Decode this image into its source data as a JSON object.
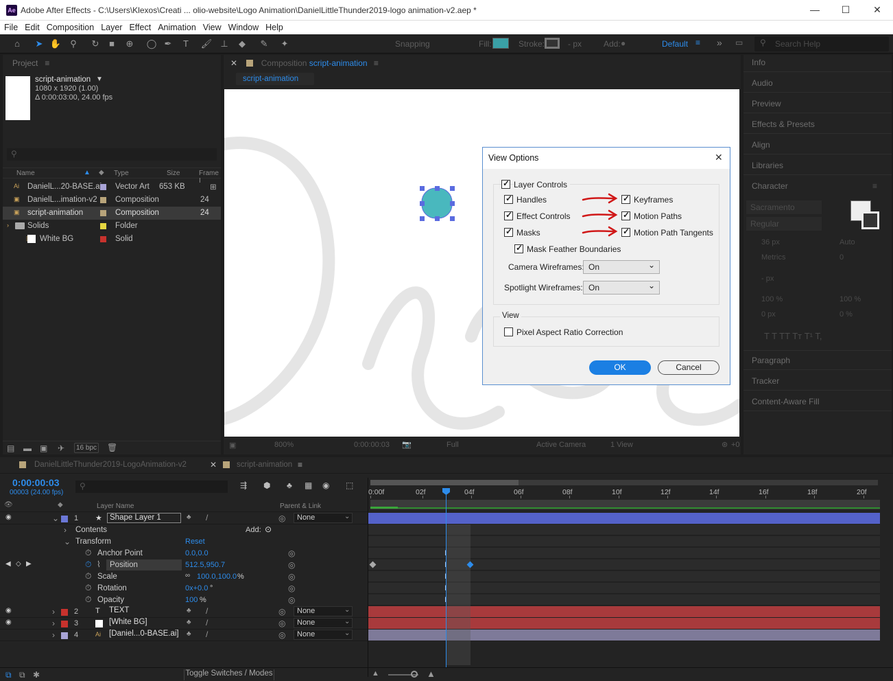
{
  "window": {
    "app_badge": "Ae",
    "title": "Adobe After Effects - C:\\Users\\Klexos\\Creati ... olio-website\\Logo Animation\\DanielLittleThunder2019-logo animation-v2.aep *",
    "minimize": "—",
    "maximize": "☐",
    "close": "✕"
  },
  "menu": [
    "File",
    "Edit",
    "Composition",
    "Layer",
    "Effect",
    "Animation",
    "View",
    "Window",
    "Help"
  ],
  "toolbar": {
    "snapping": "Snapping",
    "fill": "Fill:",
    "stroke": "Stroke:",
    "stroke_px": "- px",
    "add": "Add:",
    "workspace": "Default",
    "search": "Search Help"
  },
  "project": {
    "panel_title": "Project",
    "comp_name": "script-animation",
    "comp_dims": "1080 x 1920 (1.00)",
    "comp_dur": "Δ 0:00:03:00, 24.00 fps",
    "headers": {
      "name": "Name",
      "type": "Type",
      "size": "Size",
      "frame": "Frame I"
    },
    "items": [
      {
        "name": "DanielL...20-BASE.ai",
        "type": "Vector Art",
        "size": "653 KB",
        "frame": "",
        "color": "#a9a4d6"
      },
      {
        "name": "DanielL...imation-v2",
        "type": "Composition",
        "size": "",
        "frame": "24",
        "color": "#b8a47a"
      },
      {
        "name": "script-animation",
        "type": "Composition",
        "size": "",
        "frame": "24",
        "color": "#b8a47a"
      },
      {
        "name": "Solids",
        "type": "Folder",
        "size": "",
        "frame": "",
        "color": "#e5d641"
      },
      {
        "name": "White BG",
        "type": "Solid",
        "size": "",
        "frame": "",
        "color": "#c7322d"
      }
    ],
    "bpc": "16 bpc"
  },
  "composition": {
    "tab_prefix": "Composition",
    "tab_name": "script-animation",
    "subtab": "script-animation",
    "footer": {
      "zoom": "800%",
      "time": "0:00:00:03",
      "res": "Full",
      "camera": "Active Camera",
      "views": "1 View",
      "exposure": "+0"
    }
  },
  "right_panels": [
    "Info",
    "Audio",
    "Preview",
    "Effects & Presets",
    "Align",
    "Libraries",
    "Character",
    "Paragraph",
    "Tracker",
    "Content-Aware Fill"
  ],
  "character": {
    "font": "Sacramento",
    "style": "Regular",
    "size": "36 px",
    "leading": "Auto",
    "kerning": "Metrics",
    "tracking": "0",
    "stroke_width": "- px",
    "vscale": "100 %",
    "hscale": "100 %",
    "baseline": "0 px",
    "tsume": "0 %",
    "styles": "T  T  TT Tт  T¹  T,"
  },
  "dialog": {
    "title": "View Options",
    "layer_controls": "Layer Controls",
    "handles": "Handles",
    "keyframes": "Keyframes",
    "effect_controls": "Effect Controls",
    "motion_paths": "Motion Paths",
    "masks": "Masks",
    "motion_path_tangents": "Motion Path Tangents",
    "mask_feather": "Mask Feather Boundaries",
    "camera_wireframes_label": "Camera Wireframes:",
    "camera_wireframes": "On",
    "spotlight_wireframes_label": "Spotlight Wireframes:",
    "spotlight_wireframes": "On",
    "view_group": "View",
    "pixel_aspect": "Pixel Aspect Ratio Correction",
    "ok": "OK",
    "cancel": "Cancel"
  },
  "timeline": {
    "tab1": "DanielLittleThunder2019-LogoAnimation-v2",
    "tab2": "script-animation",
    "timecode": "0:00:00:03",
    "frames": "00003 (24.00 fps)",
    "col_layer": "Layer Name",
    "col_parent": "Parent & Link",
    "add": "Add:",
    "reset": "Reset",
    "toggle": "Toggle Switches / Modes",
    "ruler": [
      "0:00f",
      "02f",
      "04f",
      "06f",
      "08f",
      "10f",
      "12f",
      "14f",
      "16f",
      "18f",
      "20f"
    ],
    "layers": [
      {
        "num": "1",
        "name": "Shape Layer 1",
        "parent": "None",
        "color": "#6b77d6"
      },
      {
        "num": "2",
        "name": "TEXT",
        "parent": "None",
        "color": "#c7322d"
      },
      {
        "num": "3",
        "name": "[White BG]",
        "parent": "None",
        "color": "#c7322d"
      },
      {
        "num": "4",
        "name": "[Daniel...0-BASE.ai]",
        "parent": "None",
        "color": "#a9a4d6"
      }
    ],
    "props": {
      "contents": "Contents",
      "transform": "Transform",
      "anchor": "Anchor Point",
      "anchor_val": "0.0,0.0",
      "position": "Position",
      "position_val": "512.5,950.7",
      "scale": "Scale",
      "scale_val": "100.0,100.0",
      "scale_unit": "%",
      "rotation": "Rotation",
      "rotation_val": "0x+0.0",
      "rotation_unit": "°",
      "opacity": "Opacity",
      "opacity_val": "100",
      "opacity_unit": "%"
    }
  }
}
